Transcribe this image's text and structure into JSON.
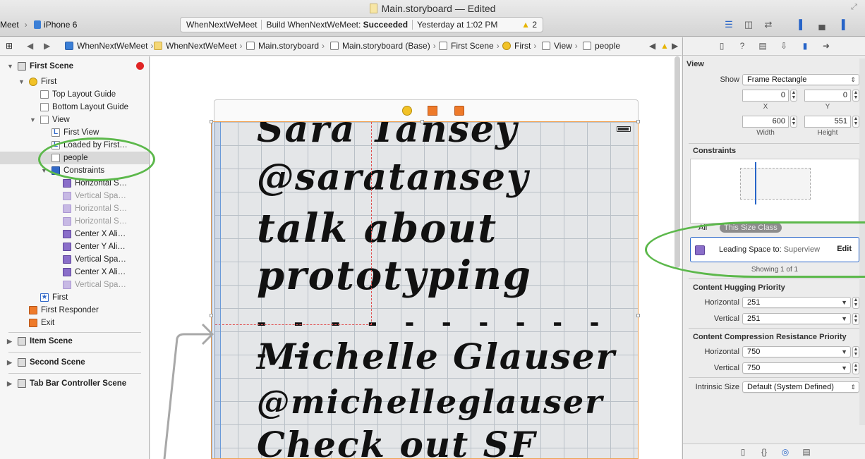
{
  "window": {
    "title": "Main.storyboard — Edited",
    "scheme_left": "Meet",
    "scheme_device": "iPhone 6"
  },
  "activity": {
    "project": "WhenNextWeMeet",
    "build_prefix": "Build WhenNextWeMeet:",
    "build_status": "Succeeded",
    "time": "Yesterday at 1:02 PM",
    "warnings": "2"
  },
  "jumpbar": {
    "items": [
      "WhenNextWeMeet",
      "WhenNextWeMeet",
      "Main.storyboard",
      "Main.storyboard (Base)",
      "First Scene",
      "First",
      "View",
      "people"
    ]
  },
  "navigator": {
    "rows": [
      {
        "label": "First Scene"
      },
      {
        "label": "First"
      },
      {
        "label": "Top Layout Guide"
      },
      {
        "label": "Bottom Layout Guide"
      },
      {
        "label": "View"
      },
      {
        "label": "First View"
      },
      {
        "label": "Loaded by First…"
      },
      {
        "label": "people"
      },
      {
        "label": "Constraints"
      },
      {
        "label": "Horizontal S…"
      },
      {
        "label": "Vertical Spa…"
      },
      {
        "label": "Horizontal S…"
      },
      {
        "label": "Horizontal S…"
      },
      {
        "label": "Center X Ali…"
      },
      {
        "label": "Center Y Ali…"
      },
      {
        "label": "Vertical Spa…"
      },
      {
        "label": "Center X Ali…"
      },
      {
        "label": "Vertical Spa…"
      },
      {
        "label": "First"
      },
      {
        "label": "First Responder"
      },
      {
        "label": "Exit"
      },
      {
        "label": "Item Scene"
      },
      {
        "label": "Second Scene"
      },
      {
        "label": "Tab Bar Controller Scene"
      }
    ]
  },
  "canvas": {
    "handwriting": {
      "line1": "Sara Tansey",
      "line2": "@saratansey",
      "line3": "talk about",
      "line4": "prototyping",
      "line5": "Michelle Glauser",
      "line6": "@michelleglauser",
      "line7": "Check out SF"
    }
  },
  "inspector": {
    "section_view": "View",
    "show_label": "Show",
    "show_value": "Frame Rectangle",
    "x_value": "0",
    "y_value": "0",
    "x_label": "X",
    "y_label": "Y",
    "width_value": "600",
    "height_value": "551",
    "width_label": "Width",
    "height_label": "Height",
    "constraints_title": "Constraints",
    "seg_all": "All",
    "seg_size_class": "This Size Class",
    "constraint_label": "Leading Space to:",
    "constraint_target": "Superview",
    "edit_label": "Edit",
    "showing": "Showing 1 of 1",
    "hugging_title": "Content Hugging Priority",
    "horizontal_label": "Horizontal",
    "vertical_label": "Vertical",
    "hug_h": "251",
    "hug_v": "251",
    "compression_title": "Content Compression Resistance Priority",
    "comp_h": "750",
    "comp_v": "750",
    "intrinsic_label": "Intrinsic Size",
    "intrinsic_value": "Default (System Defined)"
  },
  "colors": {
    "accent": "#2764c8",
    "annotation": "#5cb84b",
    "warning": "#e6b400",
    "error": "#e02424"
  }
}
